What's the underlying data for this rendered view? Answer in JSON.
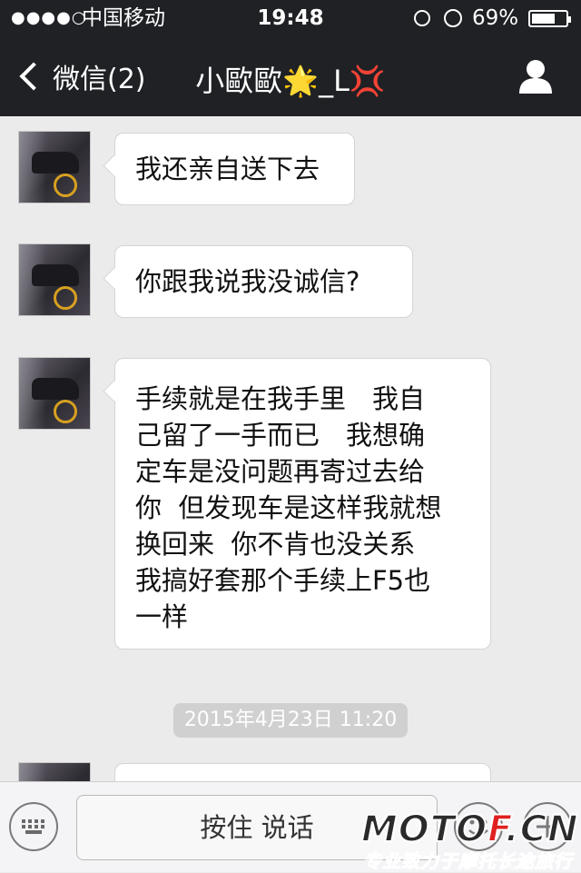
{
  "status_bar": {
    "signal_dots": "●●●●○",
    "carrier": "中国移动",
    "time": "19:48",
    "battery_percent": "69%",
    "battery_level": 0.69
  },
  "nav": {
    "back_label": "微信(2)",
    "title": "小歐歐🌟_L💢"
  },
  "messages": [
    {
      "lines": [
        "我还亲自送下去"
      ]
    },
    {
      "lines": [
        "你跟我说我没诚信?"
      ]
    },
    {
      "lines": [
        "手续就是在我手里　我自",
        "己留了一手而已　我想确",
        "定车是没问题再寄过去给",
        "你  但发现车是这样我就想",
        "换回来  你不肯也没关系",
        "我搞好套那个手续上F5也",
        "一样"
      ]
    }
  ],
  "timestamp": "2015年4月23日 11:20",
  "input_bar": {
    "hold_to_talk": "按住 说话"
  },
  "watermark": {
    "logo_main": "MOTO",
    "logo_accent": "F",
    "logo_suffix": ".CN",
    "slogan": "专业致力于摩托长途旅行"
  },
  "colors": {
    "nav_bg": "#1f2125",
    "chat_bg": "#ebebeb",
    "bubble_bg": "#ffffff",
    "timestamp_bg": "#d0d0d0"
  }
}
